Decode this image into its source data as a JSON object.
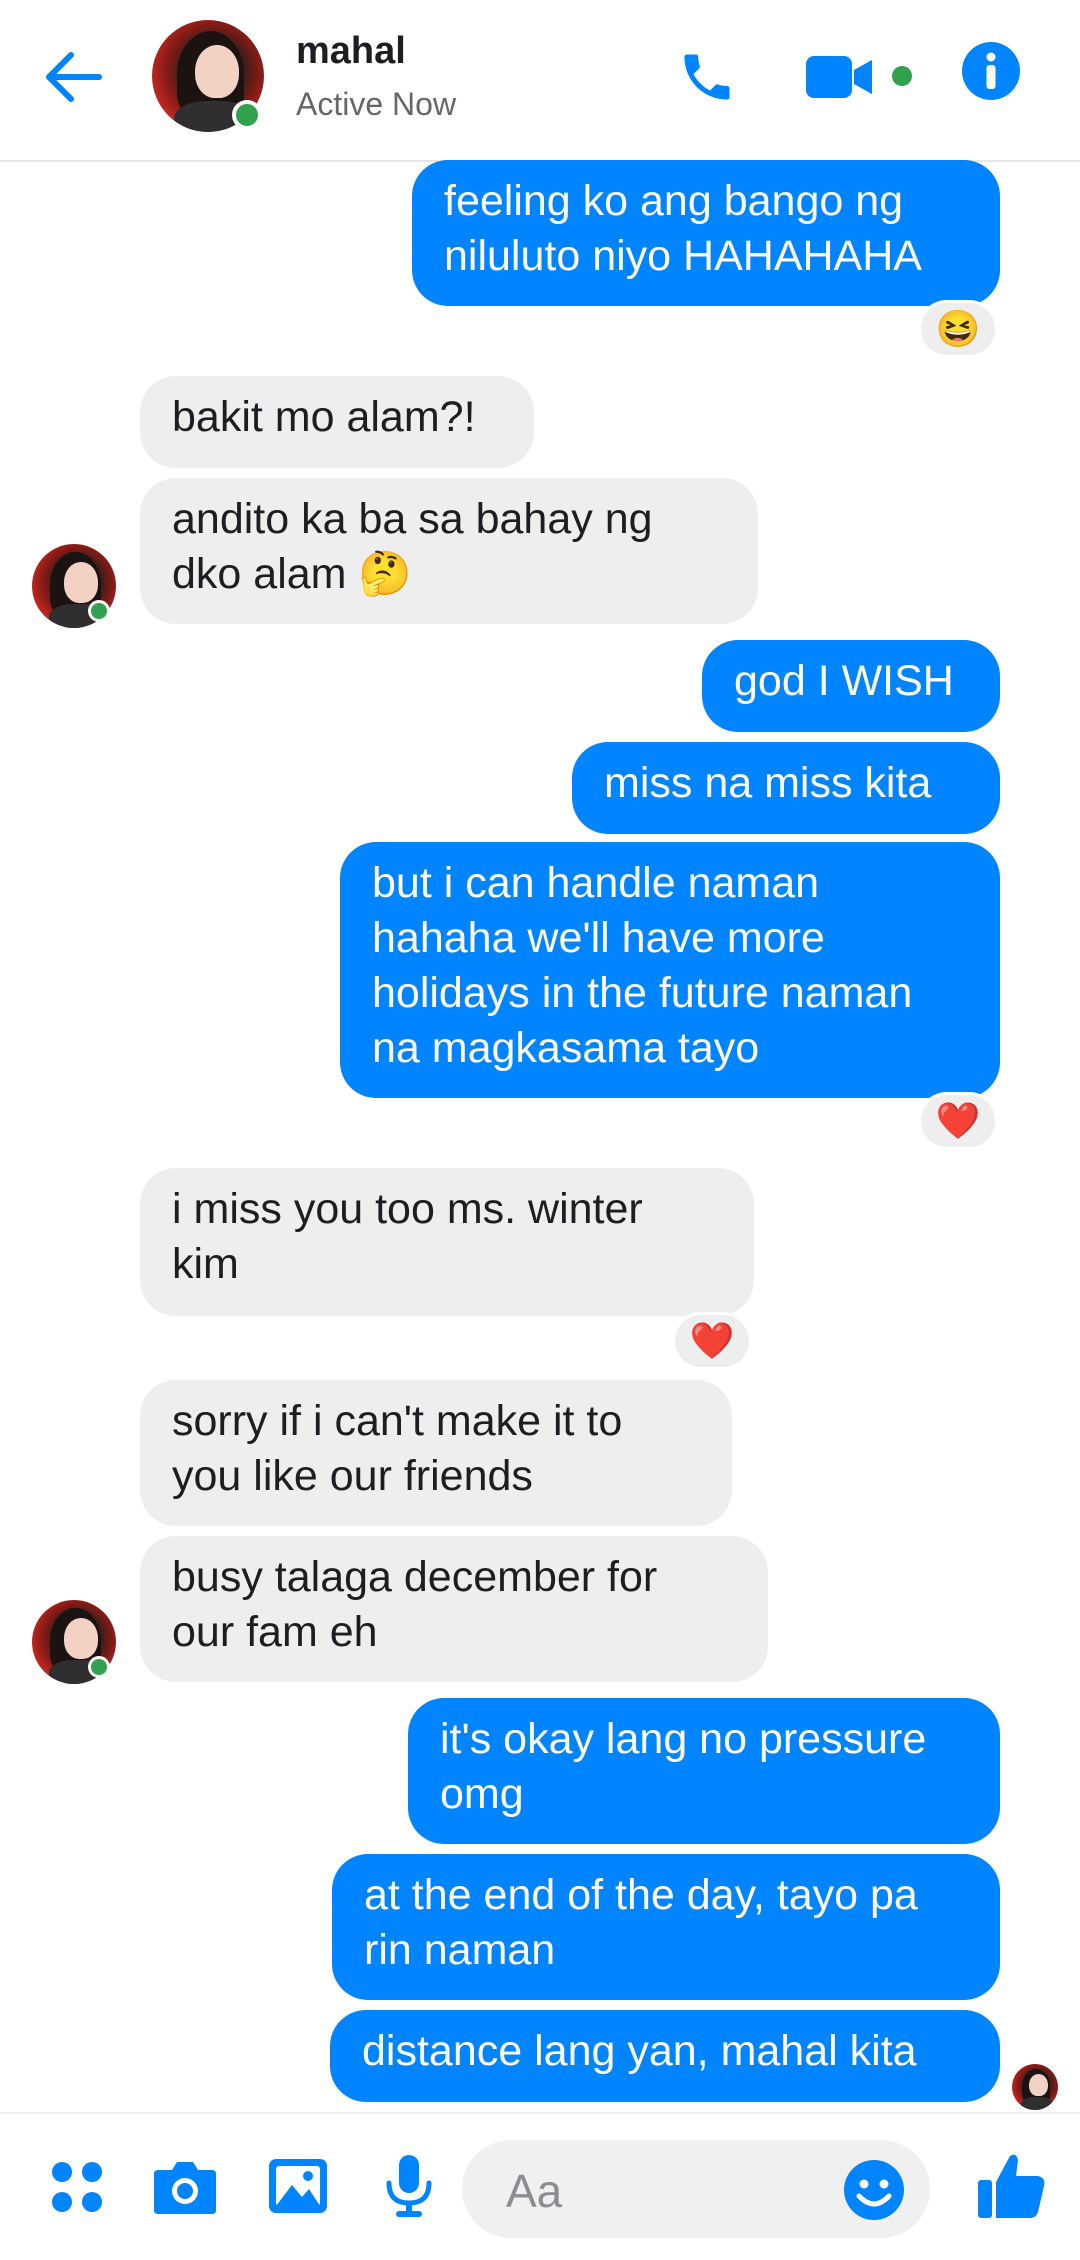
{
  "header": {
    "contact_name": "mahal",
    "status": "Active Now"
  },
  "messages": [
    {
      "from": "me",
      "text": "feeling ko ang bango ng\nniluluto niyo HAHAHAHA",
      "reaction": "😆"
    },
    {
      "from": "them",
      "text": "bakit mo alam?!"
    },
    {
      "from": "them",
      "text": "andito ka ba sa bahay ng\ndko alam 🤔"
    },
    {
      "from": "me",
      "text": "god I WISH"
    },
    {
      "from": "me",
      "text": "miss na miss kita"
    },
    {
      "from": "me",
      "text": "but i can handle naman\nhahaha we'll have more\nholidays in the future naman\nna magkasama tayo",
      "reaction": "❤️"
    },
    {
      "from": "them",
      "text": "i miss you too ms. winter\nkim",
      "reaction": "❤️"
    },
    {
      "from": "them",
      "text": "sorry if i can't make it to\nyou like our friends"
    },
    {
      "from": "them",
      "text": "busy talaga december for\nour fam eh"
    },
    {
      "from": "me",
      "text": "it's okay lang no pressure\nomg"
    },
    {
      "from": "me",
      "text": "at the end of the day, tayo pa\nrin naman"
    },
    {
      "from": "me",
      "text": "distance lang yan, mahal kita"
    }
  ],
  "composer": {
    "placeholder": "Aa"
  },
  "icons": {
    "back": "arrow-left-icon",
    "call": "phone-icon",
    "video": "video-camera-icon",
    "info": "info-icon",
    "apps": "four-dots-icon",
    "camera": "camera-icon",
    "gallery": "image-icon",
    "mic": "microphone-icon",
    "emoji": "smiley-icon",
    "like": "thumbs-up-icon"
  },
  "colors": {
    "accent": "#0084ff",
    "online": "#31a24c",
    "incoming_bubble": "#eeeeee"
  }
}
